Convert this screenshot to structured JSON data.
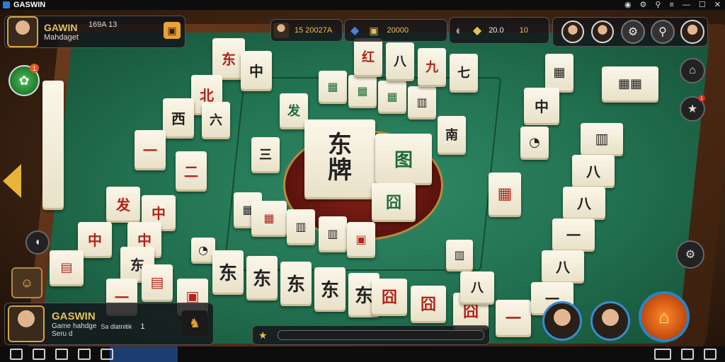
{
  "window": {
    "title": "GASWIN"
  },
  "player_top": {
    "name": "GAWIN",
    "subtitle": "Mahdaget",
    "score": "169A 13"
  },
  "top_stats": [
    {
      "value": "15  20027A"
    },
    {
      "value": "20000"
    },
    {
      "value": "20.0"
    },
    {
      "value": "10"
    }
  ],
  "player_bottom": {
    "name": "GASWIN",
    "line1": "Game hahdge",
    "line2": "Seru d",
    "tag": "Sa dlatnitik",
    "count": "1"
  },
  "tiles": {
    "center_main": "东\n牌",
    "center_right": "图",
    "center_small": "囧"
  },
  "side_badges": {
    "left_orb_notice": "1",
    "right_badge": "1"
  },
  "colors": {
    "felt": "#21704f",
    "rim": "#6a3a1c",
    "accent": "#e7a23a"
  }
}
